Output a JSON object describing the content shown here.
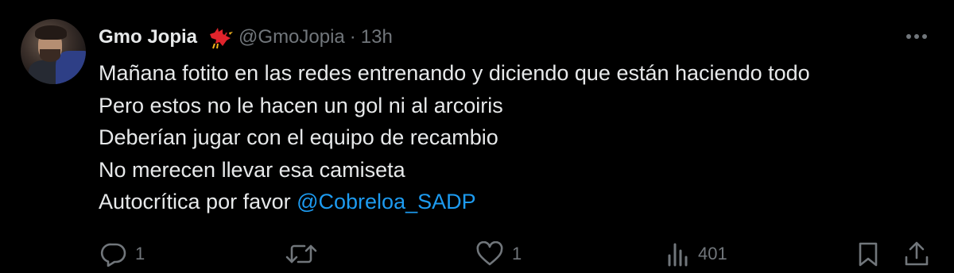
{
  "author": {
    "display_name": "Gmo Jopia",
    "handle": "@GmoJopia",
    "separator": "·",
    "time": "13h",
    "badge_icon": "red-bird-icon",
    "avatar_icon": "profile-photo"
  },
  "tweet": {
    "lines": [
      "Mañana fotito en las redes entrenando y diciendo que están haciendo todo",
      "Pero estos no le hacen un gol ni al arcoiris",
      "Deberían jugar con el equipo de recambio",
      "No merecen llevar esa camiseta",
      "Autocrítica por favor "
    ],
    "mention": "@Cobreloa_SADP"
  },
  "actions": {
    "replies": "1",
    "retweets": "",
    "likes": "1",
    "views": "401"
  },
  "colors": {
    "background": "#000000",
    "text": "#e7e9ea",
    "secondary": "#71767b",
    "link": "#1d9bf0",
    "badge": "#e0242c"
  },
  "icons": {
    "more": "more-horizontal-icon",
    "reply": "reply-bubble-icon",
    "retweet": "retweet-icon",
    "like": "heart-icon",
    "views": "views-chart-icon",
    "bookmark": "bookmark-icon",
    "share": "share-upload-icon"
  }
}
